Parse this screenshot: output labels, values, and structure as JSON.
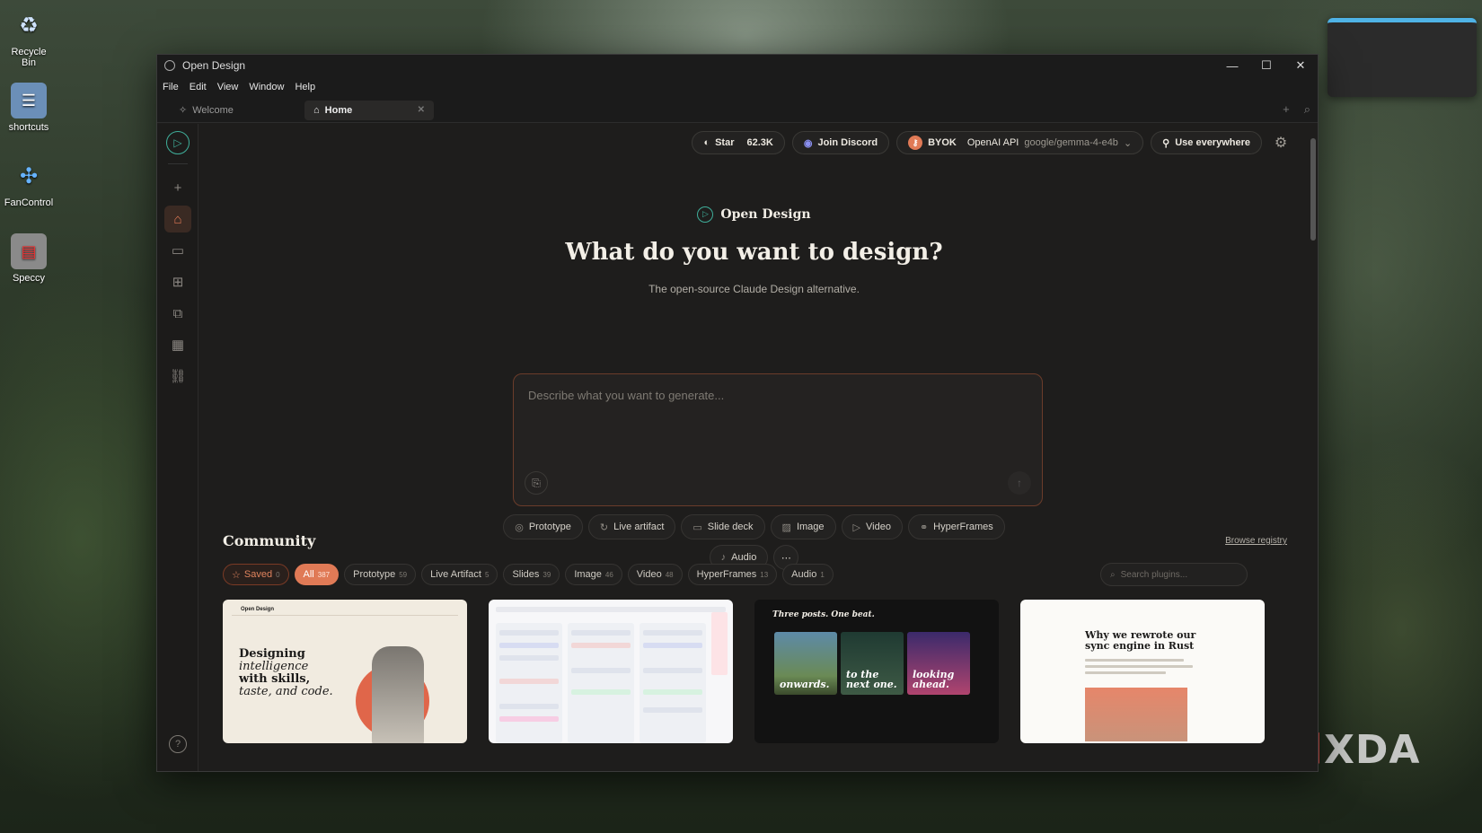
{
  "desktop": {
    "icons": [
      {
        "label": "Recycle Bin",
        "icon": "recycle-bin-icon"
      },
      {
        "label": "shortcuts",
        "icon": "folder-icon"
      },
      {
        "label": "FanControl",
        "icon": "fan-icon"
      },
      {
        "label": "Speccy",
        "icon": "speccy-icon"
      }
    ],
    "watermark": "XDA"
  },
  "window": {
    "title": "Open Design",
    "menu": [
      "File",
      "Edit",
      "View",
      "Window",
      "Help"
    ],
    "tabs": [
      {
        "label": "Welcome",
        "icon": "sparkle-icon"
      },
      {
        "label": "Home",
        "icon": "home-icon"
      }
    ]
  },
  "topbar": {
    "star_label": "Star",
    "star_count": "62.3K",
    "discord_label": "Join Discord",
    "byok_label": "BYOK",
    "api_label": "OpenAI API",
    "model": "google/gemma-4-e4b",
    "use_everywhere": "Use everywhere"
  },
  "hero": {
    "brand": "Open Design",
    "title": "What do you want to design?",
    "subtitle": "The open-source Claude Design alternative.",
    "placeholder": "Describe what you want to generate..."
  },
  "types": [
    {
      "label": "Prototype",
      "icon": "prototype-icon"
    },
    {
      "label": "Live artifact",
      "icon": "refresh-icon"
    },
    {
      "label": "Slide deck",
      "icon": "monitor-icon"
    },
    {
      "label": "Image",
      "icon": "image-icon"
    },
    {
      "label": "Video",
      "icon": "play-icon"
    },
    {
      "label": "HyperFrames",
      "icon": "link-icon"
    }
  ],
  "types_row2": [
    {
      "label": "Audio",
      "icon": "mic-icon"
    }
  ],
  "community": {
    "title": "Community",
    "browse": "Browse registry",
    "search_placeholder": "Search plugins...",
    "filters": [
      {
        "label": "Saved",
        "count": "0"
      },
      {
        "label": "All",
        "count": "387"
      },
      {
        "label": "Prototype",
        "count": "59"
      },
      {
        "label": "Live Artifact",
        "count": "5"
      },
      {
        "label": "Slides",
        "count": "39"
      },
      {
        "label": "Image",
        "count": "46"
      },
      {
        "label": "Video",
        "count": "48"
      },
      {
        "label": "HyperFrames",
        "count": "13"
      },
      {
        "label": "Audio",
        "count": "1"
      }
    ],
    "cards": {
      "c1": {
        "brand": "Open Design",
        "l1": "Designing",
        "l2": "intelligence",
        "l3": "with skills,",
        "l4": "taste, and code."
      },
      "c3": {
        "headline": "Three posts. One beat.",
        "p1": "onwards.",
        "p2": "to the next one.",
        "p3": "looking ahead."
      },
      "c4": {
        "headline": "Why we rewrote our sync engine in Rust"
      }
    }
  },
  "colors": {
    "accent": "#e07a56",
    "brand_teal": "#3fae9a",
    "bg": "#1e1d1c"
  }
}
